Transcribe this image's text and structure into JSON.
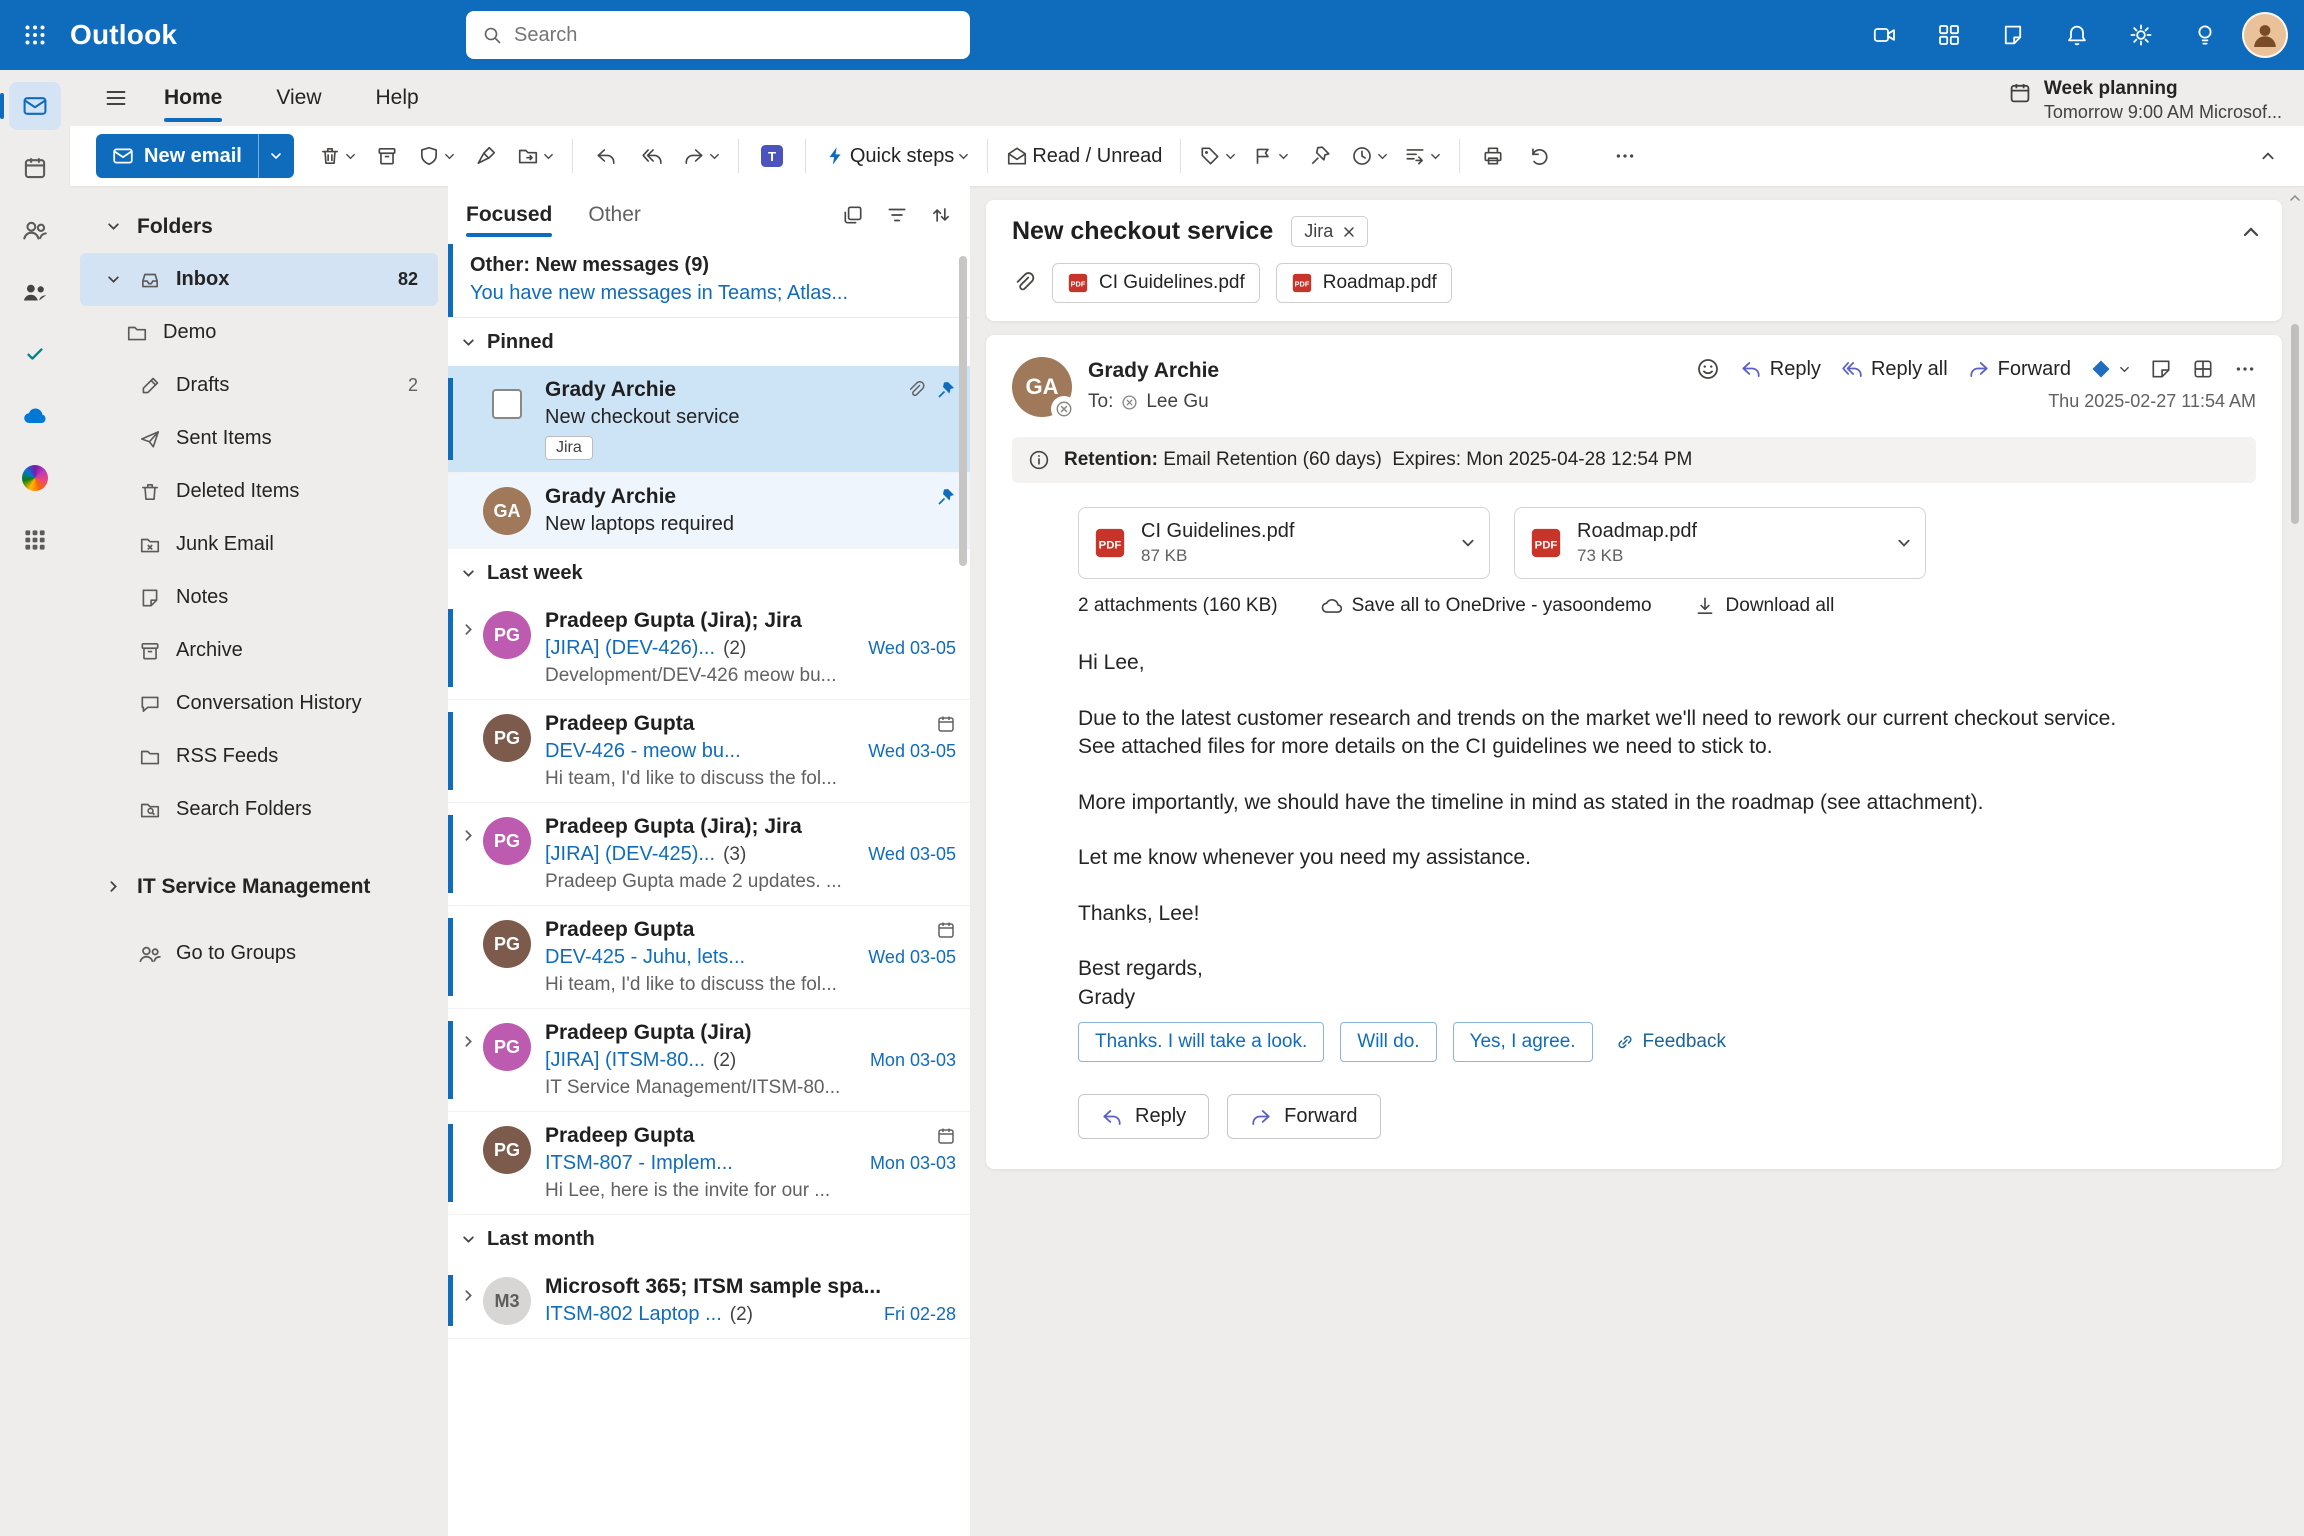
{
  "topbar": {
    "app_name": "Outlook",
    "search_placeholder": "Search"
  },
  "reminder": {
    "title": "Week planning",
    "subtitle": "Tomorrow 9:00 AM Microsof..."
  },
  "menubar": {
    "tabs": [
      {
        "label": "Home"
      },
      {
        "label": "View"
      },
      {
        "label": "Help"
      }
    ]
  },
  "ribbon": {
    "new_email_label": "New email",
    "quick_steps_label": "Quick steps",
    "read_unread_label": "Read / Unread"
  },
  "folders": {
    "header": "Folders",
    "items": [
      {
        "label": "Inbox",
        "count": "82"
      },
      {
        "label": "Demo",
        "count": ""
      },
      {
        "label": "Drafts",
        "count": "2"
      },
      {
        "label": "Sent Items",
        "count": ""
      },
      {
        "label": "Deleted Items",
        "count": ""
      },
      {
        "label": "Junk Email",
        "count": ""
      },
      {
        "label": "Notes",
        "count": ""
      },
      {
        "label": "Archive",
        "count": ""
      },
      {
        "label": "Conversation History",
        "count": ""
      },
      {
        "label": "RSS Feeds",
        "count": ""
      },
      {
        "label": "Search Folders",
        "count": ""
      }
    ],
    "section_label": "IT Service Management",
    "groups_label": "Go to Groups"
  },
  "list": {
    "tab_focused": "Focused",
    "tab_other": "Other",
    "other_banner_title": "Other: New messages (9)",
    "other_banner_preview": "You have new messages in Teams; Atlas...",
    "section_pinned": "Pinned",
    "section_last_week": "Last week",
    "section_last_month": "Last month",
    "items": [
      {
        "sender": "Grady Archie",
        "subject": "New checkout service",
        "tag": "Jira",
        "count": "",
        "date": "",
        "preview": "",
        "avatar_initials": "GA"
      },
      {
        "sender": "Grady Archie",
        "subject": "New laptops required",
        "count": "",
        "date": "",
        "preview": "",
        "avatar_initials": "GA"
      },
      {
        "sender": "Pradeep Gupta (Jira); Jira",
        "subject": "[JIRA] (DEV-426)...",
        "count": "(2)",
        "date": "Wed 03-05",
        "preview": "Development/DEV-426 meow bu...",
        "avatar_initials": "PG"
      },
      {
        "sender": "Pradeep Gupta",
        "subject": "DEV-426 - meow bu...",
        "count": "",
        "date": "Wed 03-05",
        "preview": "Hi team, I'd like to discuss the fol...",
        "avatar_initials": "PG"
      },
      {
        "sender": "Pradeep Gupta (Jira); Jira",
        "subject": "[JIRA] (DEV-425)...",
        "count": "(3)",
        "date": "Wed 03-05",
        "preview": "Pradeep Gupta made 2 updates. ...",
        "avatar_initials": "PG"
      },
      {
        "sender": "Pradeep Gupta",
        "subject": "DEV-425 - Juhu, lets...",
        "count": "",
        "date": "Wed 03-05",
        "preview": "Hi team, I'd like to discuss the fol...",
        "avatar_initials": "PG"
      },
      {
        "sender": "Pradeep Gupta (Jira)",
        "subject": "[JIRA] (ITSM-80...",
        "count": "(2)",
        "date": "Mon 03-03",
        "preview": "IT Service Management/ITSM-80...",
        "avatar_initials": "PG"
      },
      {
        "sender": "Pradeep Gupta",
        "subject": "ITSM-807 - Implem...",
        "count": "",
        "date": "Mon 03-03",
        "preview": "Hi Lee, here is the invite for our ...",
        "avatar_initials": "PG"
      },
      {
        "sender": "Microsoft 365; ITSM sample spa...",
        "subject": "ITSM-802 Laptop ...",
        "count": "(2)",
        "date": "Fri 02-28",
        "preview": "",
        "avatar_initials": "M3"
      }
    ]
  },
  "reading": {
    "subject": "New checkout service",
    "tag": "Jira",
    "header_attachments": [
      {
        "name": "CI Guidelines.pdf"
      },
      {
        "name": "Roadmap.pdf"
      }
    ],
    "message": {
      "sender": "Grady Archie",
      "sender_initials": "GA",
      "to_label": "To:",
      "recipient": "Lee Gu",
      "reply": "Reply",
      "reply_all": "Reply all",
      "forward": "Forward",
      "date": "Thu 2025-02-27 11:54 AM",
      "retention_bold": "Retention:",
      "retention_text": " Email Retention (60 days)  Expires: Mon 2025-04-28 12:54 PM",
      "attachments": [
        {
          "name": "CI Guidelines.pdf",
          "size": "87 KB"
        },
        {
          "name": "Roadmap.pdf",
          "size": "73 KB"
        }
      ],
      "attachments_summary": "2 attachments (160 KB)",
      "save_onedrive": "Save all to OneDrive - yasoondemo",
      "download_all": "Download all",
      "body": [
        "Hi Lee,",
        "Due to the latest customer research and trends on the market we'll need to rework our current checkout service. See attached files for more details on the CI guidelines we need to stick to.",
        "More importantly, we should have the timeline in mind as stated in the roadmap (see attachment).",
        "Let me know whenever you need my assistance.",
        "Thanks, Lee!",
        "Best regards,\nGrady"
      ],
      "suggestions": [
        {
          "label": "Thanks. I will take a look."
        },
        {
          "label": "Will do."
        },
        {
          "label": "Yes, I agree."
        }
      ],
      "feedback": "Feedback",
      "footer_reply": "Reply",
      "footer_forward": "Forward"
    }
  },
  "colors": {
    "brand": "#0f6cbd",
    "selected_row_bg": "#cde3f6",
    "unread_accent": "#0f6cbd"
  }
}
